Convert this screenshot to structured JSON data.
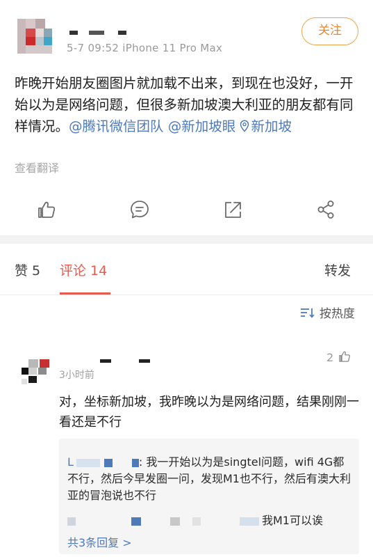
{
  "post": {
    "meta": "5-7 09:52   iPhone 11 Pro Max",
    "follow_label": "关注",
    "text_main": "昨晚开始朋友圈图片就加载不出来，到现在也没好，一开始以为是网络问题，但很多新加坡澳大利亚的朋友都有同样情况。",
    "mention_1": "@腾讯微信团队",
    "mention_2": "@新加坡眼",
    "location": "新加坡",
    "translate_label": "查看翻译",
    "actions": [
      "like-icon",
      "comment-icon",
      "share-icon",
      "forward-icon"
    ]
  },
  "tabs": {
    "likes": "赞 5",
    "comments": "评论 14",
    "reposts": "转发"
  },
  "sort_label": "按热度",
  "comment": {
    "time": "3小时前",
    "like_count": "2",
    "text": "对，坐标新加坡，我昨晚以为是网络问题，结果刚刚一看还是不行",
    "reply_1_prefix": "L",
    "reply_1_text": ": 我一开始以为是singtel问题，wifi 4G都不行，然后今早发圈一问，发现M1也不行，然后有澳大利亚的冒泡说也不行",
    "reply_2_text": "我M1可以诶",
    "more_replies": "共3条回复 >"
  },
  "colors": {
    "accent": "#e85a4f",
    "link": "#4f7ab8",
    "follow": "#e8872d"
  }
}
